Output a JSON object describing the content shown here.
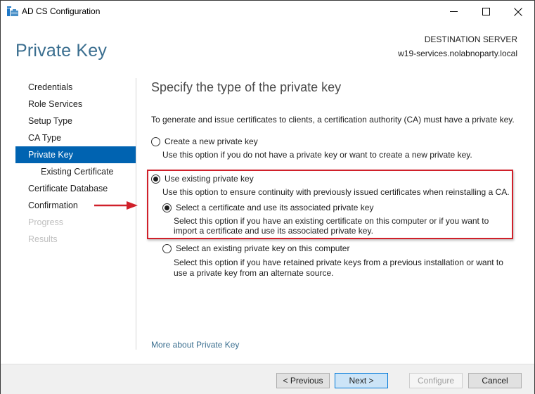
{
  "window": {
    "title": "AD CS Configuration",
    "controls": {
      "minimize": "minimize",
      "maximize": "maximize",
      "close": "close"
    }
  },
  "header": {
    "page_title": "Private Key",
    "destination_label": "DESTINATION SERVER",
    "destination_server": "w19-services.nolabnoparty.local"
  },
  "nav": {
    "items": [
      {
        "label": "Credentials",
        "state": "normal"
      },
      {
        "label": "Role Services",
        "state": "normal"
      },
      {
        "label": "Setup Type",
        "state": "normal"
      },
      {
        "label": "CA Type",
        "state": "normal"
      },
      {
        "label": "Private Key",
        "state": "active"
      },
      {
        "label": "Existing Certificate",
        "state": "sub"
      },
      {
        "label": "Certificate Database",
        "state": "normal"
      },
      {
        "label": "Confirmation",
        "state": "normal"
      },
      {
        "label": "Progress",
        "state": "disabled"
      },
      {
        "label": "Results",
        "state": "disabled"
      }
    ]
  },
  "content": {
    "section_title": "Specify the type of the private key",
    "intro": "To generate and issue certificates to clients, a certification authority (CA) must have a private key.",
    "options": {
      "create_new": {
        "label": "Create a new private key",
        "description": "Use this option if you do not have a private key or want to create a new private key.",
        "checked": false
      },
      "use_existing": {
        "label": "Use existing private key",
        "description": "Use this option to ensure continuity with previously issued certificates when reinstalling a CA.",
        "checked": true,
        "sub_options": {
          "select_certificate": {
            "label": "Select a certificate and use its associated private key",
            "description_line1": "Select this option if you have an existing certificate on this computer or if you want to",
            "description_line2": "import a certificate and use its associated private key.",
            "checked": true
          },
          "select_existing_key": {
            "label": "Select an existing private key on this computer",
            "description_line1": "Select this option if you have retained private keys from a previous installation or want to",
            "description_line2": "use a private key from an alternate source.",
            "checked": false
          }
        }
      }
    },
    "more_link": "More about Private Key"
  },
  "annotations": {
    "highlight_color": "#d0202a",
    "arrow_color": "#d0202a"
  },
  "footer": {
    "previous": "< Previous",
    "next": "Next >",
    "configure": "Configure",
    "cancel": "Cancel"
  }
}
